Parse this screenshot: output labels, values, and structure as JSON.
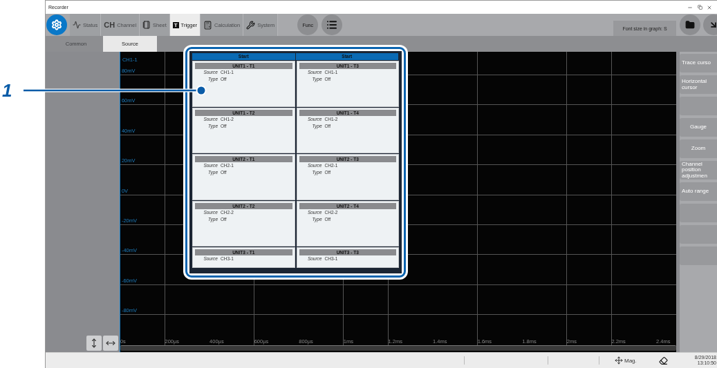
{
  "window": {
    "title": "Recorder"
  },
  "toolbar": {
    "tabs": [
      {
        "label": "Status",
        "selected": false
      },
      {
        "label": "Channel",
        "icon_text": "CH",
        "selected": false
      },
      {
        "label": "Sheet",
        "selected": false
      },
      {
        "label": "Trigger",
        "icon_text": "T",
        "selected": true
      },
      {
        "label": "Calculation",
        "selected": false
      },
      {
        "label": "System",
        "selected": false
      }
    ],
    "func_button": "Func",
    "font_size_button": "Font size in graph: S"
  },
  "sub_tabs": [
    {
      "label": "Common",
      "selected": false
    },
    {
      "label": "Source",
      "selected": true
    }
  ],
  "graph": {
    "channel": "CH1-1",
    "y_labels": [
      "80mV",
      "60mV",
      "40mV",
      "20mV",
      "0V",
      "-20mV",
      "-40mV",
      "-60mV",
      "-80mV"
    ],
    "x_labels": [
      "0s",
      "200µs",
      "400µs",
      "600µs",
      "800µs",
      "1ms",
      "1.2ms",
      "1.4ms",
      "1.6ms",
      "1.8ms",
      "2ms",
      "2.2ms",
      "2.4ms"
    ]
  },
  "side_buttons": [
    {
      "kind": "label",
      "label": "Trace curso"
    },
    {
      "kind": "label",
      "label": "Horizontal cursor"
    },
    {
      "kind": "empty"
    },
    {
      "kind": "label",
      "label": "Gauge"
    },
    {
      "kind": "label",
      "label": "Zoom"
    },
    {
      "kind": "label",
      "label": "Channel position adjustmen"
    },
    {
      "kind": "label",
      "label": "Auto range"
    },
    {
      "kind": "empty"
    },
    {
      "kind": "empty"
    },
    {
      "kind": "empty"
    }
  ],
  "trigger_panel": {
    "columns": [
      "Start",
      "Start"
    ],
    "groups": [
      {
        "cells": [
          {
            "title": "UNIT1 - T1",
            "fields": [
              {
                "label": "Source",
                "value": "CH1-1"
              },
              {
                "label": "Type",
                "value": "Off"
              }
            ]
          },
          {
            "title": "UNIT1 - T3",
            "fields": [
              {
                "label": "Source",
                "value": "CH1-1"
              },
              {
                "label": "Type",
                "value": "Off"
              }
            ]
          },
          {
            "title": "UNIT1 - T2",
            "fields": [
              {
                "label": "Source",
                "value": "CH1-2"
              },
              {
                "label": "Type",
                "value": "Off"
              }
            ]
          },
          {
            "title": "UNIT1 - T4",
            "fields": [
              {
                "label": "Source",
                "value": "CH1-2"
              },
              {
                "label": "Type",
                "value": "Off"
              }
            ]
          }
        ]
      },
      {
        "cells": [
          {
            "title": "UNIT2 - T1",
            "fields": [
              {
                "label": "Source",
                "value": "CH2-1"
              },
              {
                "label": "Type",
                "value": "Off"
              }
            ]
          },
          {
            "title": "UNIT2 - T3",
            "fields": [
              {
                "label": "Source",
                "value": "CH2-1"
              },
              {
                "label": "Type",
                "value": "Off"
              }
            ]
          },
          {
            "title": "UNIT2 - T2",
            "fields": [
              {
                "label": "Source",
                "value": "CH2-2"
              },
              {
                "label": "Type",
                "value": "Off"
              }
            ]
          },
          {
            "title": "UNIT2 - T4",
            "fields": [
              {
                "label": "Source",
                "value": "CH2-2"
              },
              {
                "label": "Type",
                "value": "Off"
              }
            ]
          }
        ]
      },
      {
        "cells": [
          {
            "title": "UNIT3 - T1",
            "fields": [
              {
                "label": "Source",
                "value": "CH3-1"
              }
            ]
          },
          {
            "title": "UNIT3 - T3",
            "fields": [
              {
                "label": "Source",
                "value": "CH3-1"
              }
            ]
          }
        ]
      }
    ]
  },
  "callout": "1",
  "status_bar": {
    "mag_label": "Mag.",
    "date": "8/29/2018",
    "time": "13:10:50"
  }
}
